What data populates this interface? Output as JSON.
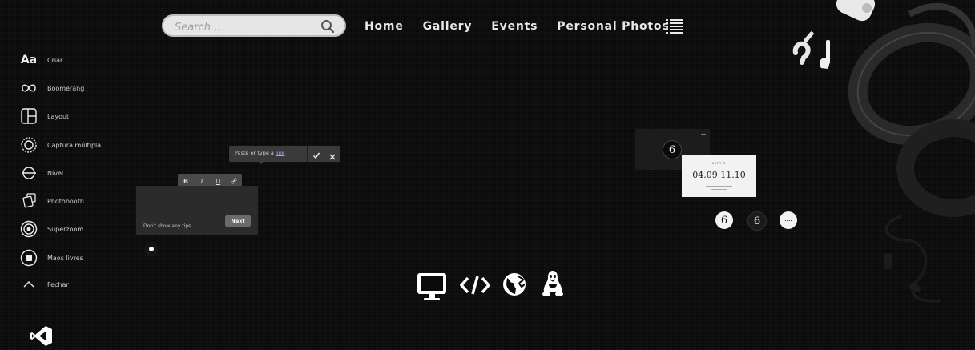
{
  "search": {
    "placeholder": "Search..."
  },
  "nav": {
    "items": [
      "Home",
      "Gallery",
      "Events",
      "Personal Photos"
    ]
  },
  "tools": [
    {
      "icon": "text-aa-icon",
      "label": "Criar",
      "glyph": "Aa"
    },
    {
      "icon": "infinity-icon",
      "label": "Boomerang"
    },
    {
      "icon": "layout-icon",
      "label": "Layout"
    },
    {
      "icon": "multi-capture-icon",
      "label": "Captura múltipla"
    },
    {
      "icon": "level-icon",
      "label": "Nível"
    },
    {
      "icon": "photobooth-icon",
      "label": "Photobooth"
    },
    {
      "icon": "superzoom-icon",
      "label": "Superzoom"
    },
    {
      "icon": "hands-free-icon",
      "label": "Maos livres"
    },
    {
      "icon": "chevron-up-icon",
      "label": "Fechar"
    }
  ],
  "link_popup": {
    "text": "Paste or type a ",
    "link_word": "link"
  },
  "format_bar": {
    "bold": "B",
    "italic": "I",
    "underline": "U"
  },
  "tip": {
    "dont_show": "Don't show any tips",
    "next": "Next"
  },
  "invite_card": {
    "date": "04.09 11.10",
    "small": "KATY'S"
  },
  "logo_glyph": "6",
  "tech_icons": [
    "monitor-icon",
    "code-icon",
    "globe-icon",
    "linux-icon"
  ],
  "colors": {
    "background": "#0b0b0b",
    "search_bg": "#e6e6e6",
    "nav_text": "#e8e8e8",
    "popup_bg": "#3a3a3a",
    "link": "#9ea7ff"
  }
}
